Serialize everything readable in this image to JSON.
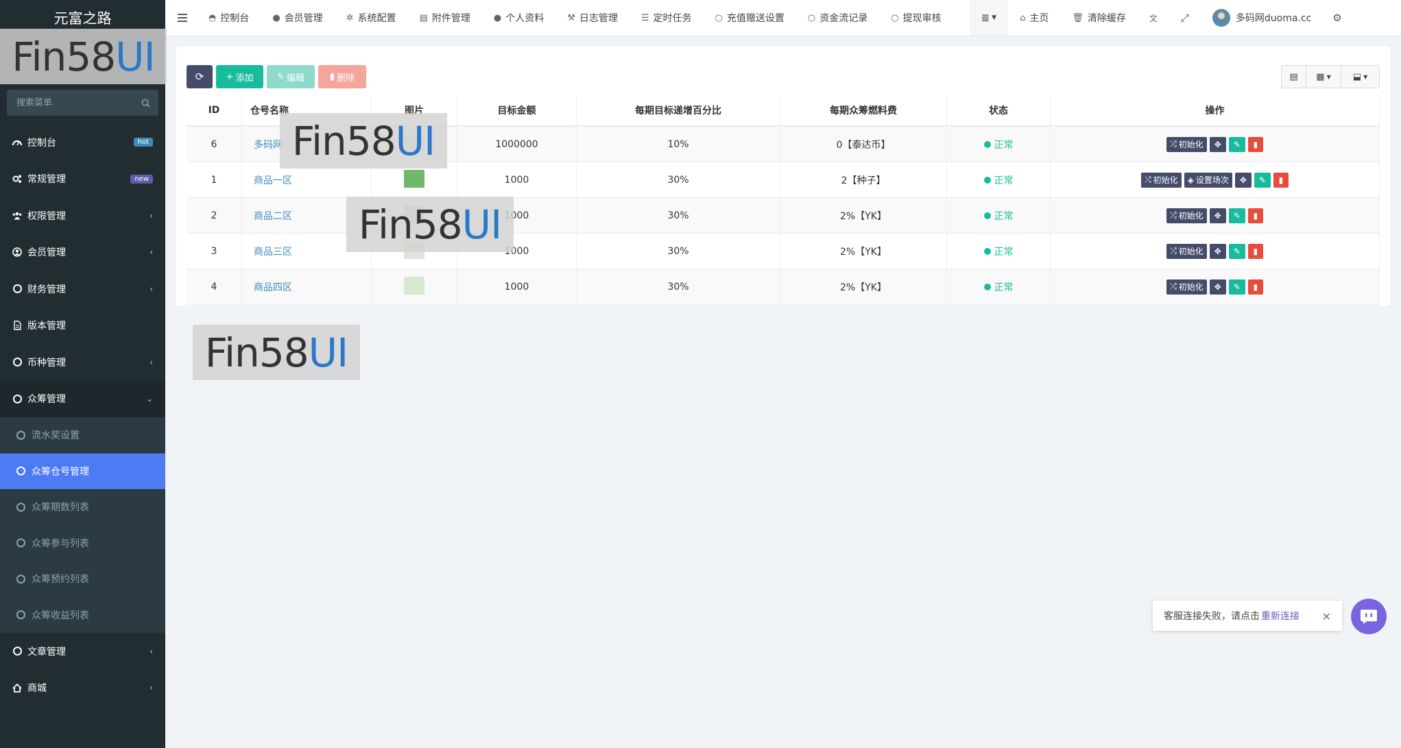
{
  "sidebar": {
    "brand": "元富之路",
    "search_placeholder": "搜索菜单",
    "items": [
      {
        "label": "控制台",
        "badge": "hot"
      },
      {
        "label": "常规管理",
        "badge": "new"
      },
      {
        "label": "权限管理"
      },
      {
        "label": "会员管理"
      },
      {
        "label": "财务管理"
      },
      {
        "label": "版本管理"
      },
      {
        "label": "币种管理"
      },
      {
        "label": "众筹管理"
      }
    ],
    "sub_items": [
      {
        "label": "流水奖设置"
      },
      {
        "label": "众筹仓号管理"
      },
      {
        "label": "众筹期数列表"
      },
      {
        "label": "众筹参与列表"
      },
      {
        "label": "众筹预约列表"
      },
      {
        "label": "众筹收益列表"
      }
    ],
    "items_after": [
      {
        "label": "文章管理"
      },
      {
        "label": "商城"
      }
    ]
  },
  "watermark": {
    "prefix": "Fin58",
    "suffix": "UI"
  },
  "navbar": {
    "items": [
      "控制台",
      "会员管理",
      "系统配置",
      "附件管理",
      "个人资料",
      "日志管理",
      "定时任务",
      "充值赠送设置",
      "资金流记录",
      "提现审核"
    ],
    "home": "主页",
    "clear_cache": "清除缓存",
    "user": "多码网duoma.cc"
  },
  "toolbar": {
    "add": "添加",
    "edit": "编辑",
    "delete": "删除"
  },
  "table": {
    "headers": [
      "ID",
      "仓号名称",
      "图片",
      "目标金额",
      "每期目标递增百分比",
      "每期众筹燃料费",
      "状态",
      "操作"
    ],
    "rows": [
      {
        "id": "6",
        "name": "多码网",
        "amount": "1000000",
        "pct": "10%",
        "fee": "0【泰达币】",
        "status": "正常",
        "set_field": false
      },
      {
        "id": "1",
        "name": "商品一区",
        "amount": "1000",
        "pct": "30%",
        "fee": "2【种子】",
        "status": "正常",
        "set_field": true
      },
      {
        "id": "2",
        "name": "商品二区",
        "amount": "1000",
        "pct": "30%",
        "fee": "2%【YK】",
        "status": "正常",
        "set_field": false
      },
      {
        "id": "3",
        "name": "商品三区",
        "amount": "1000",
        "pct": "30%",
        "fee": "2%【YK】",
        "status": "正常",
        "set_field": false
      },
      {
        "id": "4",
        "name": "商品四区",
        "amount": "1000",
        "pct": "30%",
        "fee": "2%【YK】",
        "status": "正常",
        "set_field": false
      }
    ],
    "op_init": "初始化",
    "op_set_field": "设置场次"
  },
  "toast": {
    "text": "客服连接失败，请点击",
    "reconnect": "重新连接",
    "close": "×"
  },
  "colors": {
    "sidebar": "#222d32",
    "active": "#4d7bf3",
    "green": "#18bc9c",
    "red": "#e74c3c",
    "dark_btn": "#444c69"
  }
}
